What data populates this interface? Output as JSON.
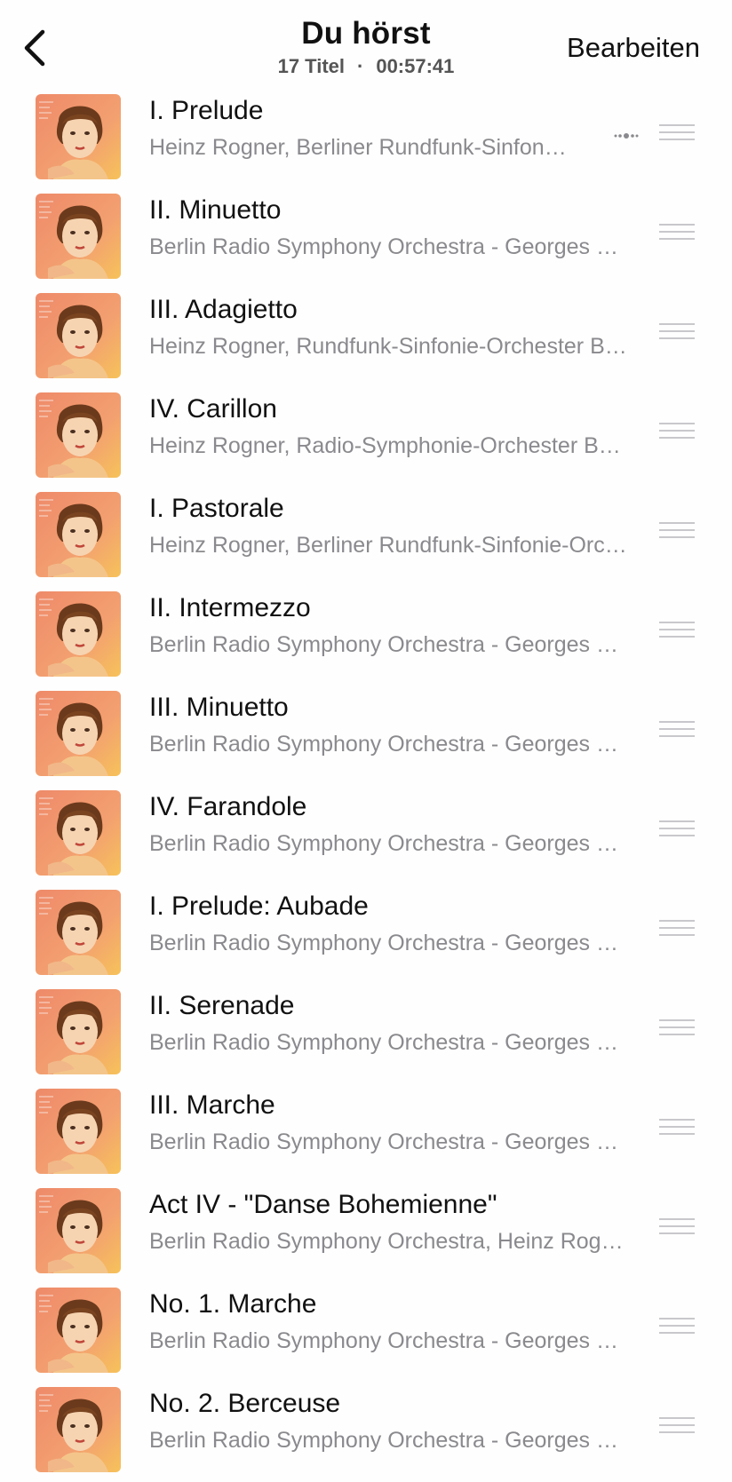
{
  "header": {
    "title": "Du hörst",
    "count": "17 Titel",
    "separator": "·",
    "duration": "00:57:41",
    "edit_label": "Bearbeiten"
  },
  "tracks": [
    {
      "title": "I. Prelude",
      "artist": "Heinz Rogner, Berliner Rundfunk-Sinfonie-Orchester",
      "playing": true
    },
    {
      "title": "II. Minuetto",
      "artist": "Berlin Radio Symphony Orchestra - Georges Bizet"
    },
    {
      "title": "III. Adagietto",
      "artist": "Heinz Rogner, Rundfunk-Sinfonie-Orchester Berlin"
    },
    {
      "title": "IV. Carillon",
      "artist": "Heinz Rogner, Radio-Symphonie-Orchester Berlin"
    },
    {
      "title": "I. Pastorale",
      "artist": "Heinz Rogner, Berliner Rundfunk-Sinfonie-Orchester"
    },
    {
      "title": "II. Intermezzo",
      "artist": "Berlin Radio Symphony Orchestra - Georges Bizet"
    },
    {
      "title": "III. Minuetto",
      "artist": "Berlin Radio Symphony Orchestra - Georges Bizet"
    },
    {
      "title": "IV. Farandole",
      "artist": "Berlin Radio Symphony Orchestra - Georges Bizet"
    },
    {
      "title": "I. Prelude: Aubade",
      "artist": "Berlin Radio Symphony Orchestra - Georges Bizet"
    },
    {
      "title": "II. Serenade",
      "artist": "Berlin Radio Symphony Orchestra - Georges Bizet"
    },
    {
      "title": "III. Marche",
      "artist": "Berlin Radio Symphony Orchestra - Georges Bizet"
    },
    {
      "title": "Act IV - \"Danse Bohemienne\"",
      "artist": "Berlin Radio Symphony Orchestra, Heinz Rogner"
    },
    {
      "title": "No. 1. Marche",
      "artist": "Berlin Radio Symphony Orchestra - Georges Bizet"
    },
    {
      "title": "No. 2. Berceuse",
      "artist": "Berlin Radio Symphony Orchestra - Georges Bizet"
    }
  ],
  "icons": {
    "back": "chevron-left-icon",
    "reorder": "reorder-handle-icon",
    "now_playing": "now-playing-indicator-icon"
  },
  "colors": {
    "subtitle": "#8a8a8e",
    "handle": "#c8c8cc",
    "art_bg": "#f0a070"
  }
}
